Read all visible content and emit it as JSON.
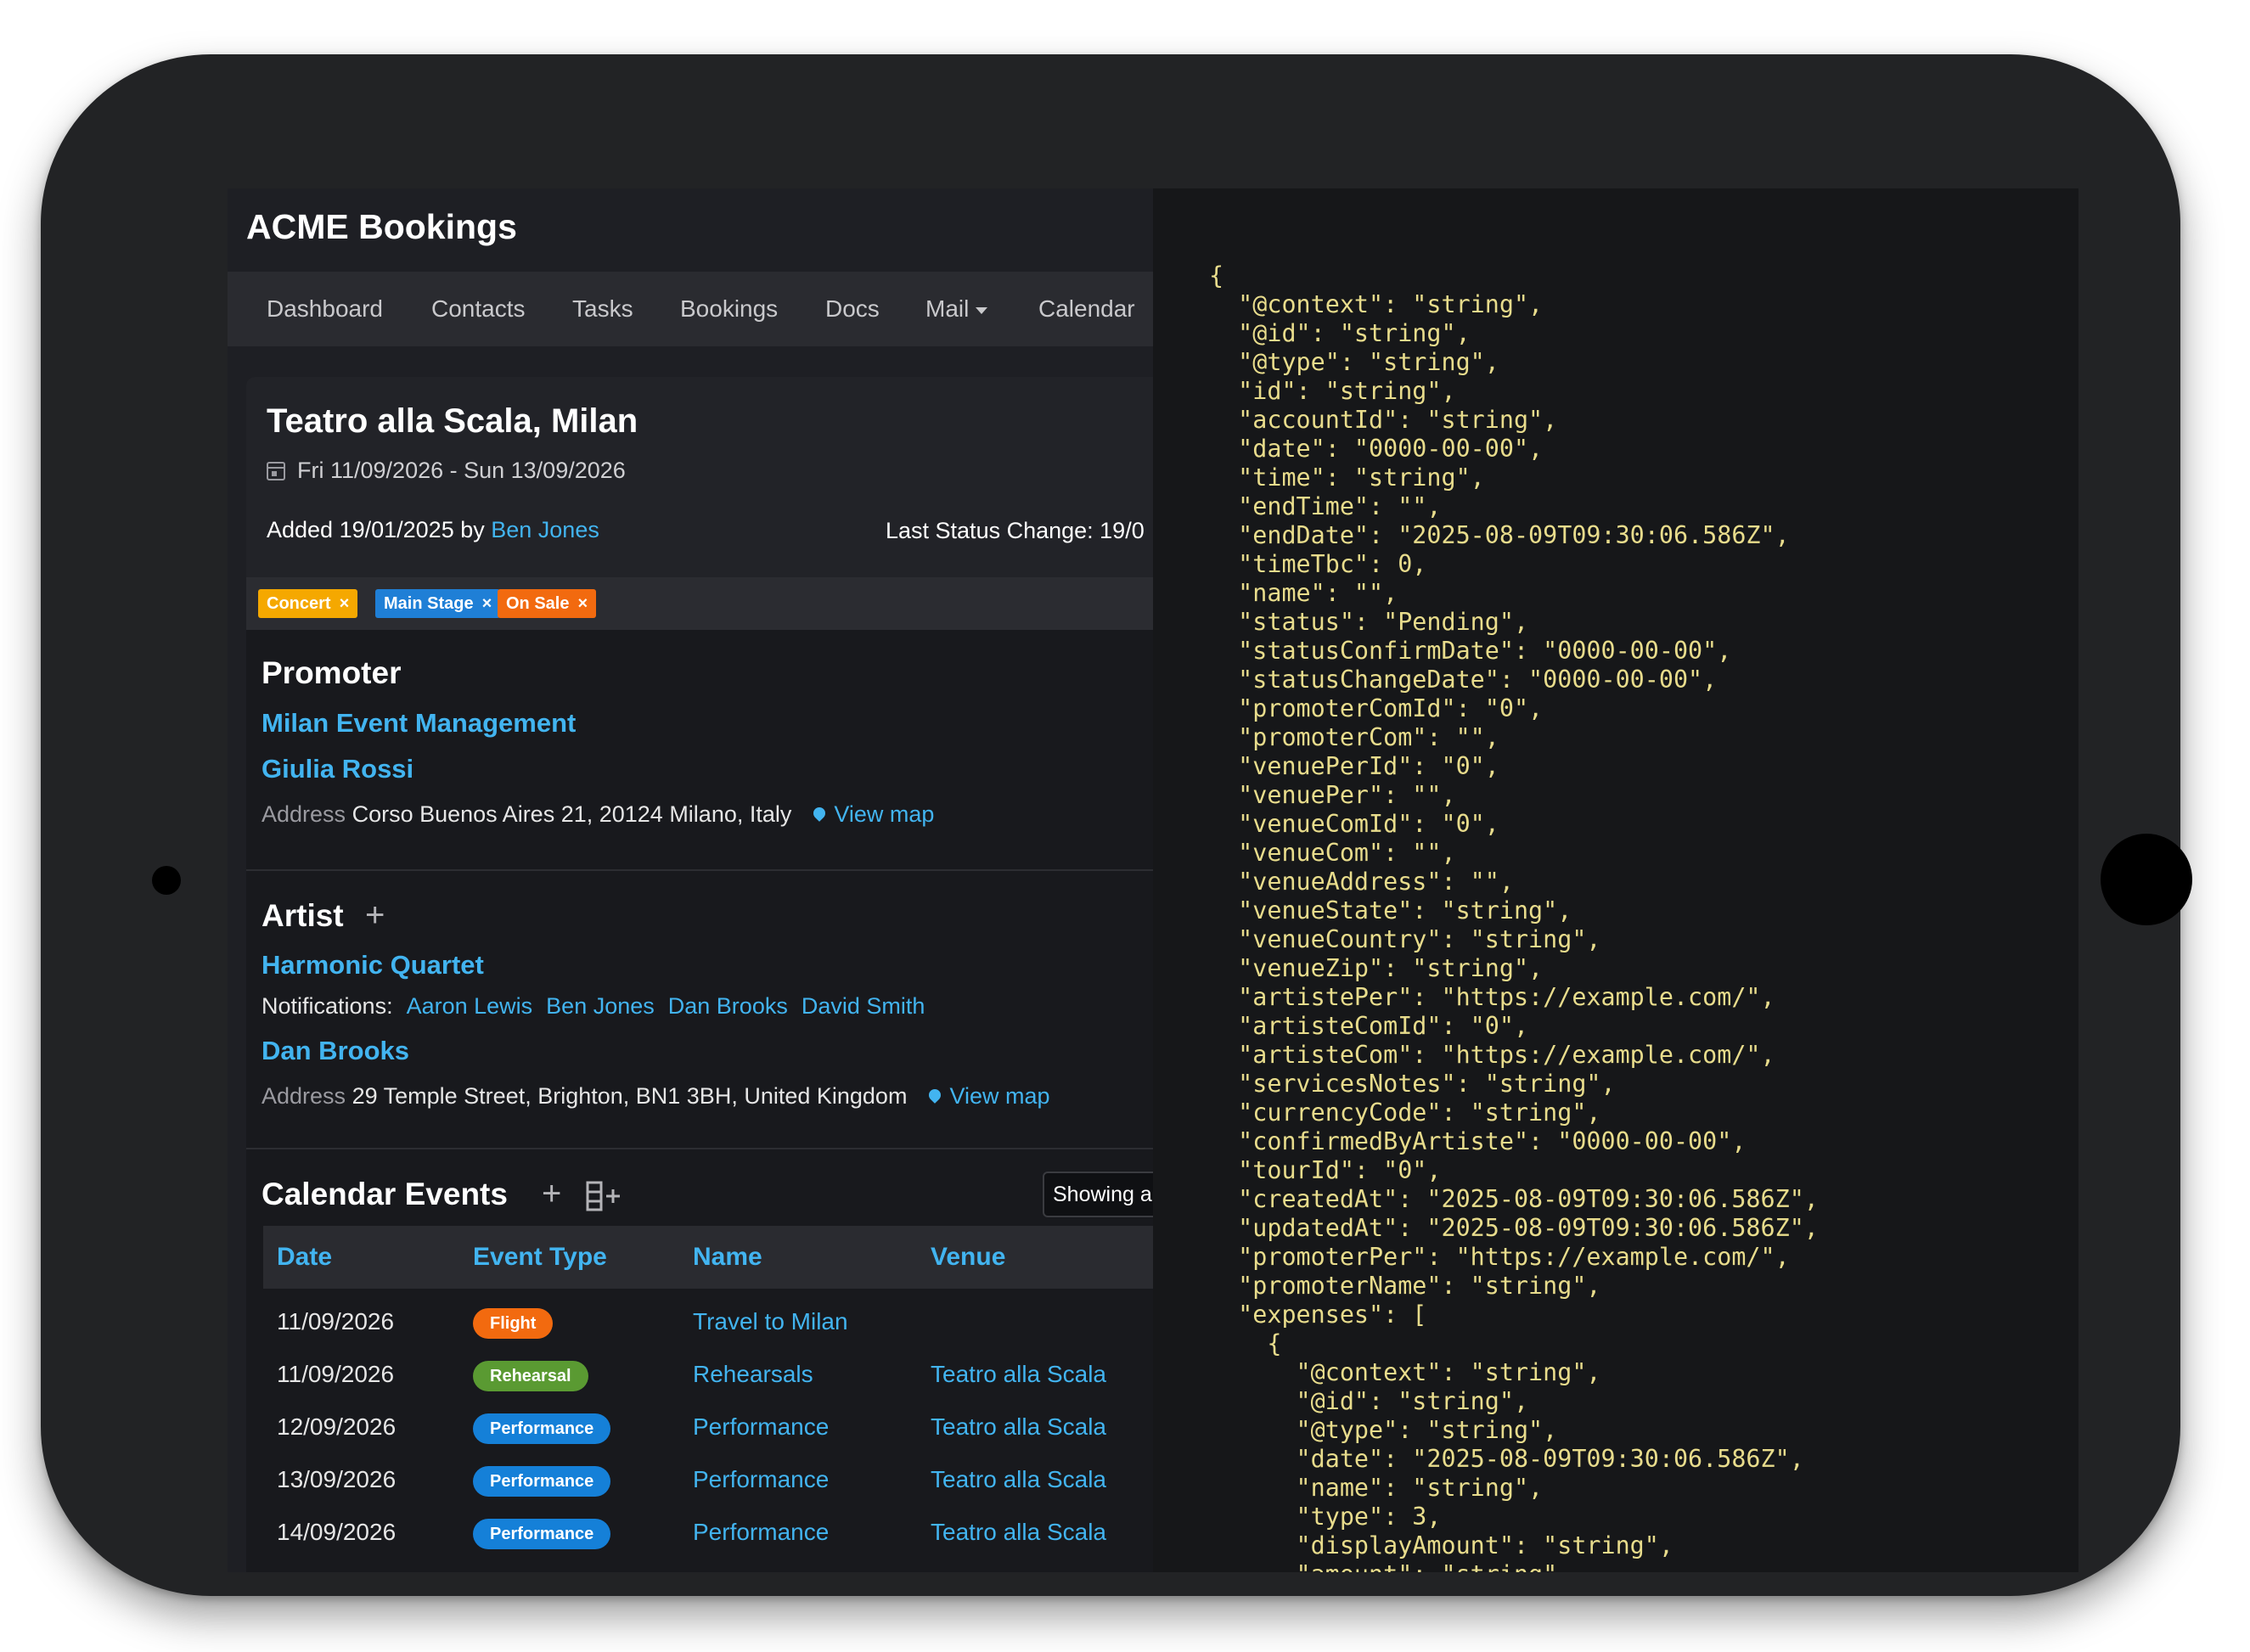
{
  "app": {
    "title": "ACME Bookings"
  },
  "nav": {
    "items": [
      {
        "label": "Dashboard"
      },
      {
        "label": "Contacts"
      },
      {
        "label": "Tasks"
      },
      {
        "label": "Bookings"
      },
      {
        "label": "Docs"
      },
      {
        "label": "Mail"
      },
      {
        "label": "Calendar"
      }
    ]
  },
  "booking": {
    "venue_title": "Teatro alla Scala, Milan",
    "date_range": "Fri 11/09/2026 - Sun 13/09/2026",
    "added_prefix": "Added 19/01/2025 by",
    "added_by": "Ben Jones",
    "status_change": "Last Status Change: 19/0"
  },
  "tags": [
    {
      "label": "Concert",
      "color": "#f5a800"
    },
    {
      "label": "Main Stage",
      "color": "#1f7fd6"
    },
    {
      "label": "On Sale",
      "color": "#f26a0f"
    }
  ],
  "promoter": {
    "heading": "Promoter",
    "company": "Milan Event Management",
    "person": "Giulia Rossi",
    "address_label": "Address",
    "address": "Corso Buenos Aires 21, 20124 Milano, Italy",
    "view_map": "View map"
  },
  "artist": {
    "heading": "Artist",
    "name": "Harmonic Quartet",
    "notifications_label": "Notifications:",
    "notifications": [
      "Aaron Lewis",
      "Ben Jones",
      "Dan Brooks",
      "David Smith"
    ],
    "contact": "Dan Brooks",
    "address_label": "Address",
    "address": "29 Temple Street, Brighton, BN1 3BH, United Kingdom",
    "view_map": "View map"
  },
  "calendar": {
    "heading": "Calendar Events",
    "filter_label": "Showing all",
    "columns": [
      "Date",
      "Event Type",
      "Name",
      "Venue"
    ],
    "rows": [
      {
        "date": "11/09/2026",
        "type": "Flight",
        "type_color": "#f26a0f",
        "name": "Travel to Milan",
        "venue": ""
      },
      {
        "date": "11/09/2026",
        "type": "Rehearsal",
        "type_color": "#5a9a32",
        "name": "Rehearsals",
        "venue": "Teatro alla Scala"
      },
      {
        "date": "12/09/2026",
        "type": "Performance",
        "type_color": "#1580d8",
        "name": "Performance",
        "venue": "Teatro alla Scala"
      },
      {
        "date": "13/09/2026",
        "type": "Performance",
        "type_color": "#1580d8",
        "name": "Performance",
        "venue": "Teatro alla Scala"
      },
      {
        "date": "14/09/2026",
        "type": "Performance",
        "type_color": "#1580d8",
        "name": "Performance",
        "venue": "Teatro alla Scala"
      }
    ]
  },
  "json_view": {
    "text": "{\n  \"@context\": \"string\",\n  \"@id\": \"string\",\n  \"@type\": \"string\",\n  \"id\": \"string\",\n  \"accountId\": \"string\",\n  \"date\": \"0000-00-00\",\n  \"time\": \"string\",\n  \"endTime\": \"\",\n  \"endDate\": \"2025-08-09T09:30:06.586Z\",\n  \"timeTbc\": 0,\n  \"name\": \"\",\n  \"status\": \"Pending\",\n  \"statusConfirmDate\": \"0000-00-00\",\n  \"statusChangeDate\": \"0000-00-00\",\n  \"promoterComId\": \"0\",\n  \"promoterCom\": \"\",\n  \"venuePerId\": \"0\",\n  \"venuePer\": \"\",\n  \"venueComId\": \"0\",\n  \"venueCom\": \"\",\n  \"venueAddress\": \"\",\n  \"venueState\": \"string\",\n  \"venueCountry\": \"string\",\n  \"venueZip\": \"string\",\n  \"artistePer\": \"https://example.com/\",\n  \"artisteComId\": \"0\",\n  \"artisteCom\": \"https://example.com/\",\n  \"servicesNotes\": \"string\",\n  \"currencyCode\": \"string\",\n  \"confirmedByArtiste\": \"0000-00-00\",\n  \"tourId\": \"0\",\n  \"createdAt\": \"2025-08-09T09:30:06.586Z\",\n  \"updatedAt\": \"2025-08-09T09:30:06.586Z\",\n  \"promoterPer\": \"https://example.com/\",\n  \"promoterName\": \"string\",\n  \"expenses\": [\n    {\n      \"@context\": \"string\",\n      \"@id\": \"string\",\n      \"@type\": \"string\",\n      \"date\": \"2025-08-09T09:30:06.586Z\",\n      \"name\": \"string\",\n      \"type\": 3,\n      \"displayAmount\": \"string\",\n      \"amount\": \"string\","
  }
}
